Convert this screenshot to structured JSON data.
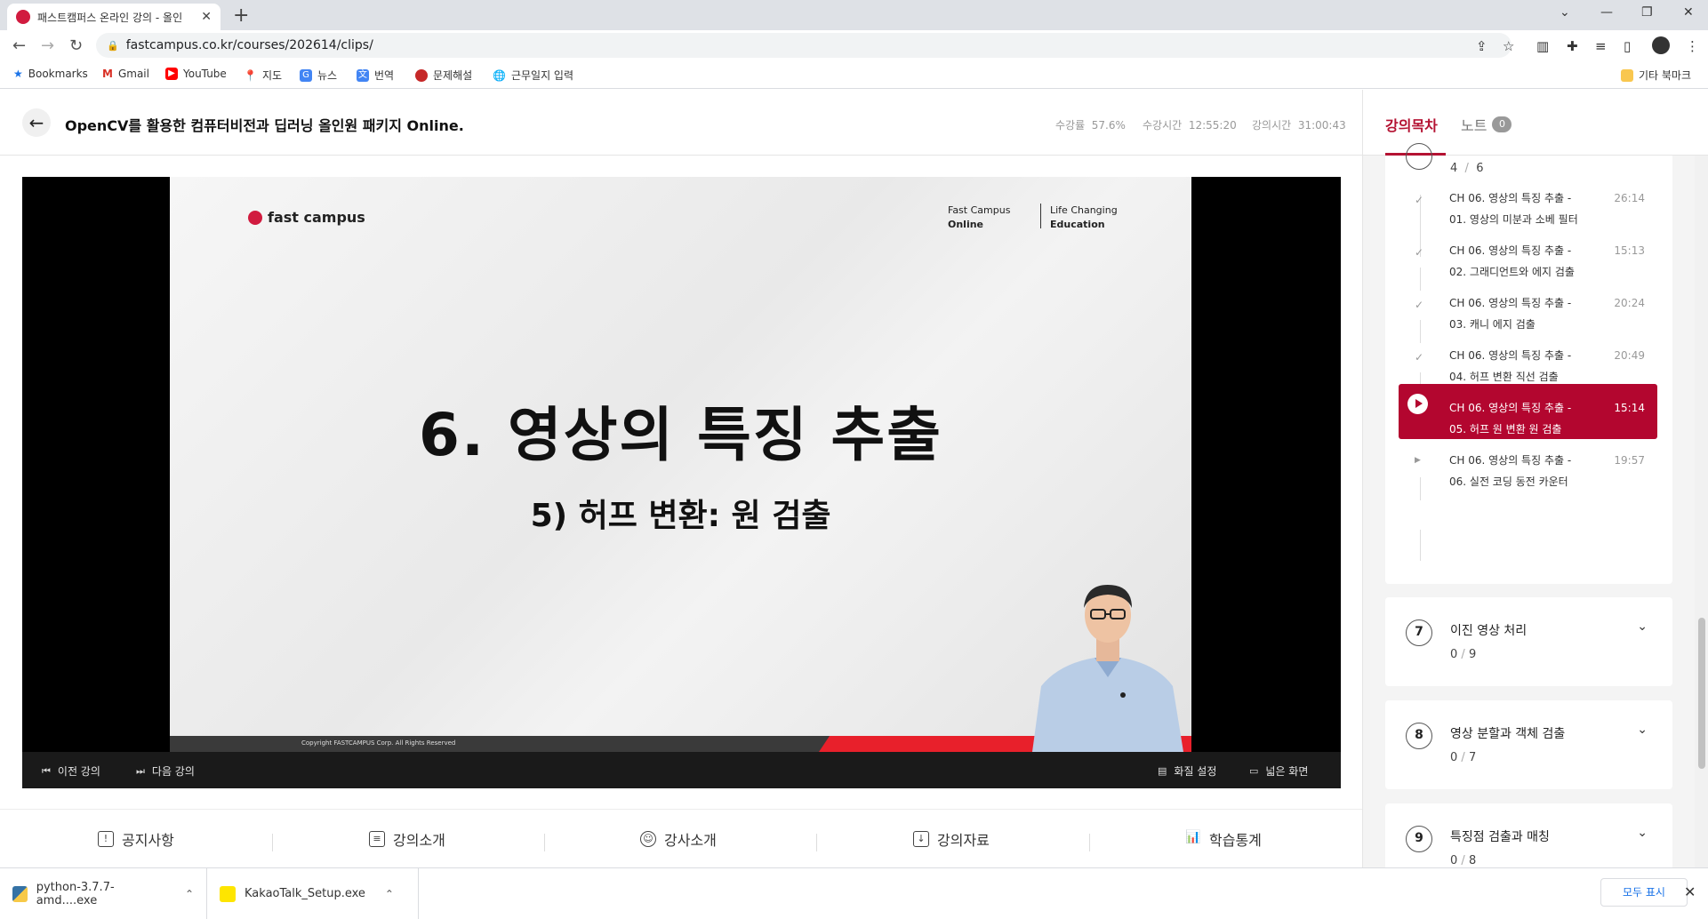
{
  "browser": {
    "tab_title": "패스트캠퍼스 온라인 강의 - 올인",
    "new_tab": "+",
    "url": "fastcampus.co.kr/courses/202614/clips/",
    "bookmarks": [
      "Bookmarks",
      "Gmail",
      "YouTube",
      "지도",
      "뉴스",
      "번역",
      "문제해설",
      "근무일지 입력"
    ],
    "other_bookmarks": "기타 북마크"
  },
  "course": {
    "title": "OpenCV를 활용한 컴퓨터비전과 딥러닝 올인원 패키지 Online.",
    "progress_label": "수강률",
    "progress_value": "57.6%",
    "watch_time_label": "수강시간",
    "watch_time_value": "12:55:20",
    "lecture_time_label": "강의시간",
    "lecture_time_value": "31:00:43"
  },
  "slide": {
    "logo": "fast campus",
    "tag1_line1": "Fast Campus",
    "tag1_line2": "Online",
    "tag2_line1": "Life Changing",
    "tag2_line2": "Education",
    "title": "6. 영상의 특징 추출",
    "subtitle": "5) 허프 변환: 원 검출",
    "copyright": "Copyright FASTCAMPUS Corp. All Rights Reserved"
  },
  "controls": {
    "prev": "이전 강의",
    "next": "다음 강의",
    "quality": "화질 설정",
    "wide": "넓은 화면"
  },
  "bottom_tabs": [
    "공지사항",
    "강의소개",
    "강사소개",
    "강의자료",
    "학습통계"
  ],
  "panel": {
    "tab_toc": "강의목차",
    "tab_note": "노트",
    "note_count": "0",
    "current_chapter_done": "4",
    "current_chapter_total": "6",
    "lectures": [
      {
        "line1": "CH 06. 영상의 특징 추출 -",
        "line2": "01. 영상의 미분과 소베 필터",
        "duration": "26:14",
        "state": "done"
      },
      {
        "line1": "CH 06. 영상의 특징 추출 -",
        "line2": "02. 그래디언트와 에지 검출",
        "duration": "15:13",
        "state": "done"
      },
      {
        "line1": "CH 06. 영상의 특징 추출 -",
        "line2": "03. 캐니 에지 검출",
        "duration": "20:24",
        "state": "done"
      },
      {
        "line1": "CH 06. 영상의 특징 추출 -",
        "line2": "04. 허프 변환 직선 검출",
        "duration": "20:49",
        "state": "done"
      },
      {
        "line1": "CH 06. 영상의 특징 추출 -",
        "line2": "05. 허프 원 변환 원 검출",
        "duration": "15:14",
        "state": "playing"
      },
      {
        "line1": "CH 06. 영상의 특징 추출 -",
        "line2": "06. 실전 코딩 동전 카운터",
        "duration": "19:57",
        "state": "pending"
      }
    ],
    "chapters": [
      {
        "num": "7",
        "title": "이진 영상 처리",
        "done": "0",
        "total": "9"
      },
      {
        "num": "8",
        "title": "영상 분할과 객체 검출",
        "done": "0",
        "total": "7"
      },
      {
        "num": "9",
        "title": "특징점 검출과 매칭",
        "done": "0",
        "total": "8"
      }
    ]
  },
  "downloads": {
    "file1": "python-3.7.7-amd....exe",
    "file2": "KakaoTalk_Setup.exe",
    "show_all": "모두 표시"
  },
  "colors": {
    "brand_red": "#b3062f",
    "slide_accent": "#e8202b"
  }
}
